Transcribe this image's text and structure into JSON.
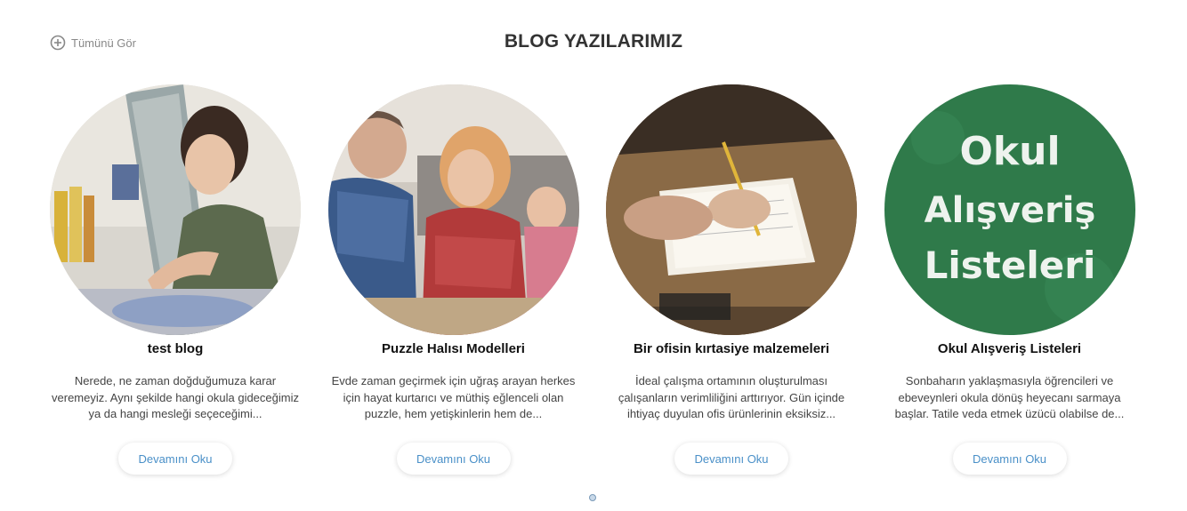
{
  "header": {
    "see_all_label": "Tümünü Gör",
    "see_all_icon": "plus-circle-icon",
    "title": "BLOG YAZILARIMIZ"
  },
  "cards": [
    {
      "title": "test blog",
      "excerpt": "Nerede, ne zaman doğduğumuza karar veremeyiz. Aynı şekilde hangi okula gideceğimiz ya da hangi mesleği seçeceğimi...",
      "button": "Devamını Oku",
      "image": "woman-painting-photo"
    },
    {
      "title": "Puzzle Halısı Modelleri",
      "excerpt": "Evde zaman geçirmek için uğraş arayan herkes için hayat kurtarıcı ve müthiş eğlenceli olan puzzle, hem yetişkinlerin hem de...",
      "button": "Devamını Oku",
      "image": "family-puzzle-photo"
    },
    {
      "title": "Bir ofisin kırtasiye malzemeleri",
      "excerpt": "İdeal çalışma ortamının oluşturulması çalışanların verimliliğini arttırıyor. Gün içinde ihtiyaç duyulan ofis ürünlerinin eksiksiz...",
      "button": "Devamını Oku",
      "image": "office-writing-photo"
    },
    {
      "title": "Okul Alışveriş Listeleri",
      "excerpt": "Sonbaharın yaklaşmasıyla öğrencileri ve ebeveynleri okula dönüş heyecanı sarmaya başlar. Tatile veda etmek üzücü olabilse de...",
      "button": "Devamını Oku",
      "image": "chalkboard-photo",
      "image_text": [
        "Okul",
        "Alışveriş",
        "Listeleri"
      ]
    }
  ],
  "colors": {
    "accent": "#4a90c8",
    "chalkboard": "#2f7a4a"
  }
}
